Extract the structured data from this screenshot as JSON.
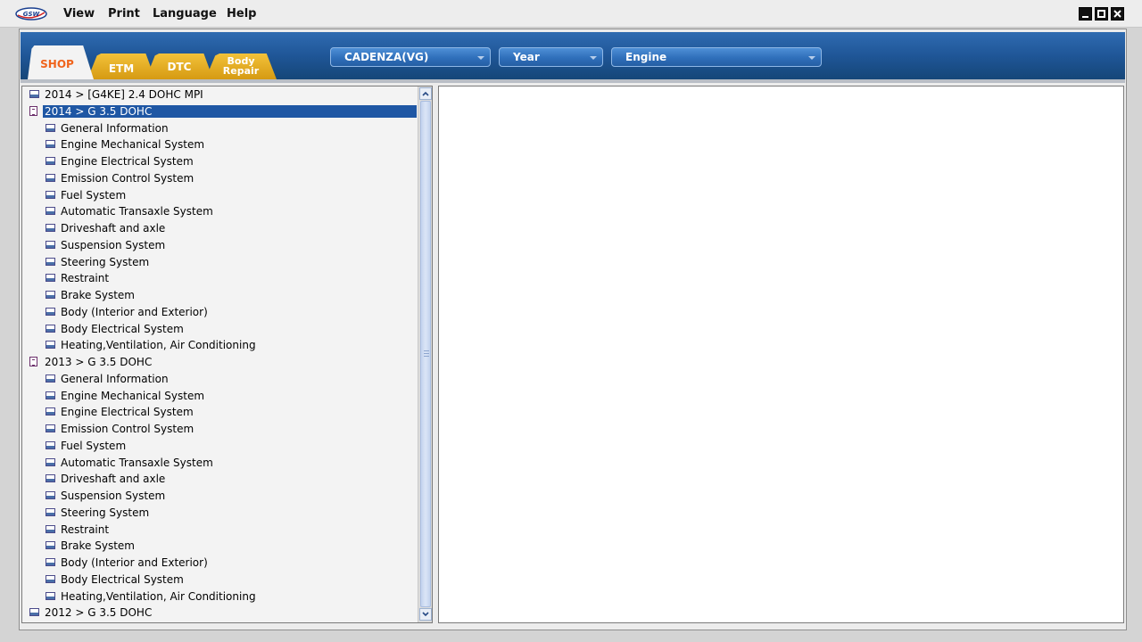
{
  "menubar": {
    "logo_text": "GSW",
    "items": [
      "View",
      "Print",
      "Language",
      "Help"
    ]
  },
  "window_controls": [
    "minimize",
    "maximize",
    "close"
  ],
  "tabs": {
    "shop": "SHOP",
    "etm": "ETM",
    "dtc": "DTC",
    "body_repair_line1": "Body",
    "body_repair_line2": "Repair"
  },
  "selectors": {
    "model": "CADENZA(VG)",
    "year": "Year",
    "engine": "Engine"
  },
  "tree": [
    {
      "level": 0,
      "label": "2014 > [G4KE] 2.4 DOHC MPI",
      "icon": "closed-book-icon",
      "selected": false
    },
    {
      "level": 0,
      "label": "2014 > G 3.5 DOHC",
      "icon": "open-book-icon",
      "selected": true
    },
    {
      "level": 1,
      "label": "General Information",
      "icon": "page-icon"
    },
    {
      "level": 1,
      "label": "Engine Mechanical System",
      "icon": "page-icon"
    },
    {
      "level": 1,
      "label": "Engine Electrical System",
      "icon": "page-icon"
    },
    {
      "level": 1,
      "label": "Emission Control System",
      "icon": "page-icon"
    },
    {
      "level": 1,
      "label": "Fuel System",
      "icon": "page-icon"
    },
    {
      "level": 1,
      "label": "Automatic Transaxle System",
      "icon": "page-icon"
    },
    {
      "level": 1,
      "label": "Driveshaft and axle",
      "icon": "page-icon"
    },
    {
      "level": 1,
      "label": "Suspension System",
      "icon": "page-icon"
    },
    {
      "level": 1,
      "label": "Steering System",
      "icon": "page-icon"
    },
    {
      "level": 1,
      "label": "Restraint",
      "icon": "page-icon"
    },
    {
      "level": 1,
      "label": "Brake System",
      "icon": "page-icon"
    },
    {
      "level": 1,
      "label": "Body (Interior and Exterior)",
      "icon": "page-icon"
    },
    {
      "level": 1,
      "label": "Body Electrical System",
      "icon": "page-icon"
    },
    {
      "level": 1,
      "label": "Heating,Ventilation, Air Conditioning",
      "icon": "page-icon"
    },
    {
      "level": 0,
      "label": "2013 > G 3.5 DOHC",
      "icon": "open-book-icon",
      "selected": false
    },
    {
      "level": 1,
      "label": "General Information",
      "icon": "page-icon"
    },
    {
      "level": 1,
      "label": "Engine Mechanical System",
      "icon": "page-icon"
    },
    {
      "level": 1,
      "label": "Engine Electrical System",
      "icon": "page-icon"
    },
    {
      "level": 1,
      "label": "Emission Control System",
      "icon": "page-icon"
    },
    {
      "level": 1,
      "label": "Fuel System",
      "icon": "page-icon"
    },
    {
      "level": 1,
      "label": "Automatic Transaxle System",
      "icon": "page-icon"
    },
    {
      "level": 1,
      "label": "Driveshaft and axle",
      "icon": "page-icon"
    },
    {
      "level": 1,
      "label": "Suspension System",
      "icon": "page-icon"
    },
    {
      "level": 1,
      "label": "Steering System",
      "icon": "page-icon"
    },
    {
      "level": 1,
      "label": "Restraint",
      "icon": "page-icon"
    },
    {
      "level": 1,
      "label": "Brake System",
      "icon": "page-icon"
    },
    {
      "level": 1,
      "label": "Body (Interior and Exterior)",
      "icon": "page-icon"
    },
    {
      "level": 1,
      "label": "Body Electrical System",
      "icon": "page-icon"
    },
    {
      "level": 1,
      "label": "Heating,Ventilation, Air Conditioning",
      "icon": "page-icon"
    },
    {
      "level": 0,
      "label": "2012 > G 3.5 DOHC",
      "icon": "closed-book-icon",
      "selected": false
    }
  ],
  "colors": {
    "band": "#1f5697",
    "selection": "#1f57a4",
    "shop_tab_text": "#f0641c",
    "gold_tab": "#e8b22a"
  }
}
